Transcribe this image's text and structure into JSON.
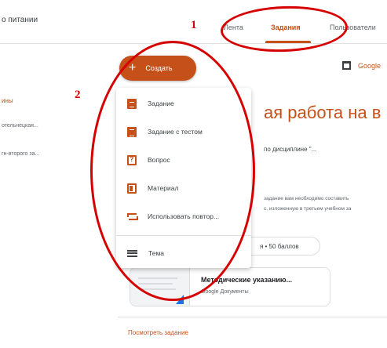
{
  "header": {
    "course_title": "о питании",
    "tabs": [
      {
        "label": "Лента"
      },
      {
        "label": "Задания",
        "active": true
      },
      {
        "label": "Пользователи"
      }
    ]
  },
  "annotations": {
    "marker_1": "1",
    "marker_2": "2",
    "color": "#d50000"
  },
  "create_button": {
    "icon": "plus-icon",
    "label": "Создать"
  },
  "calendar_link": {
    "icon": "calendar-icon",
    "label": "Google"
  },
  "topics": {
    "active": "ины",
    "items": [
      "отельнецкая...",
      "гн-второго за..."
    ]
  },
  "assignment": {
    "title": "ая работа на в",
    "subtitle": "по дисциплине \"...",
    "description": [
      "задание вам необходимо составить",
      "с, изложенную в третьем учебном за"
    ],
    "points": "я • 50 баллов",
    "attachment": {
      "title": "Методические указанию...",
      "type": "Google Документы"
    },
    "view_link": "Посмотреть задание"
  },
  "create_menu": {
    "items": [
      {
        "icon": "assignment-icon",
        "label": "Задание"
      },
      {
        "icon": "quiz-assignment-icon",
        "label": "Задание с тестом"
      },
      {
        "icon": "question-icon",
        "label": "Вопрос"
      },
      {
        "icon": "material-icon",
        "label": "Материал"
      },
      {
        "icon": "reuse-post-icon",
        "label": "Использовать повтор..."
      },
      {
        "icon": "topic-icon",
        "label": "Тема"
      }
    ]
  },
  "colors": {
    "accent": "#c5501a",
    "text": "#3c4043",
    "muted": "#5f6368",
    "divider": "#e0e0e0"
  }
}
